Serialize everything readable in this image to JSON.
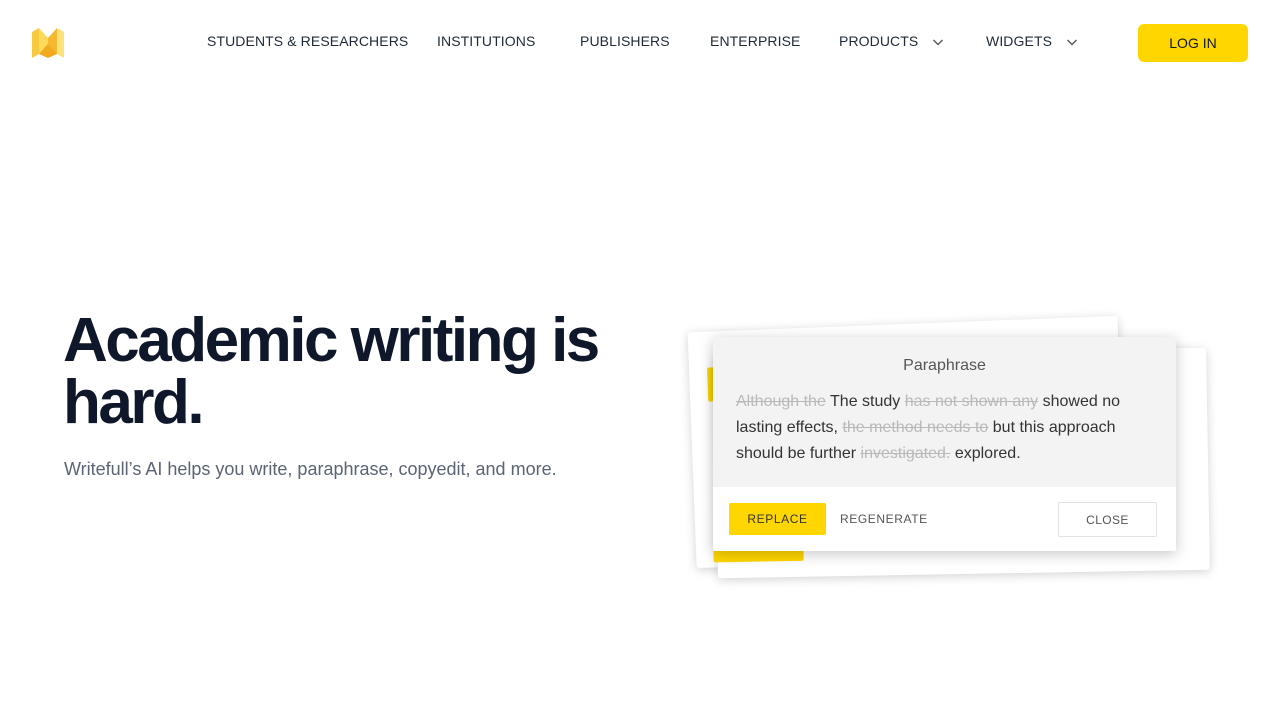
{
  "header": {
    "logo_icon": "writefull-logo-icon",
    "nav": [
      {
        "label": "STUDENTS & RESEARCHERS"
      },
      {
        "label": "INSTITUTIONS"
      },
      {
        "label": "PUBLISHERS"
      },
      {
        "label": "ENTERPRISE"
      },
      {
        "label": "PRODUCTS",
        "icon": "chevron-down-icon"
      },
      {
        "label": "WIDGETS",
        "icon": "chevron-down-icon"
      }
    ],
    "login_label": "LOG IN",
    "accent_color": "#FFD600"
  },
  "hero": {
    "title": "Academic writing is hard.",
    "subtitle": "Writefull’s AI helps you write, paraphrase, copyedit, and more."
  },
  "card": {
    "heading": "Paraphrase",
    "segments": [
      {
        "text": "Although the",
        "deleted": true
      },
      {
        "text": "The study",
        "deleted": false
      },
      {
        "text": "has not shown any",
        "deleted": true
      },
      {
        "text": "showed no lasting effects,",
        "deleted": false
      },
      {
        "text": "the method needs to",
        "deleted": true
      },
      {
        "text": "but this approach should be further",
        "deleted": false
      },
      {
        "text": "investigated.",
        "deleted": true
      },
      {
        "text": "explored.",
        "deleted": false
      }
    ],
    "replace_label": "REPLACE",
    "regenerate_label": "REGENERATE",
    "close_label": "CLOSE"
  }
}
